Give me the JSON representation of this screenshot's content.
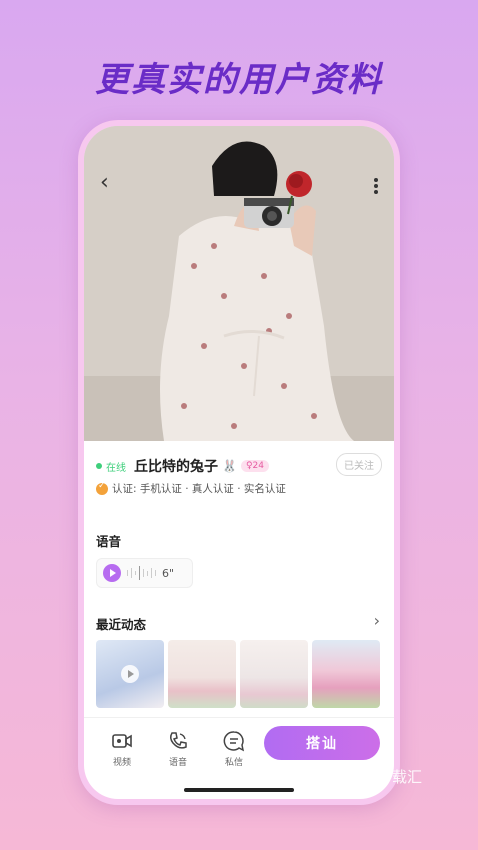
{
  "headline": "更真实的用户资料",
  "profile": {
    "online_status": "在线",
    "username": "丘比特的兔子",
    "rabbit_emoji": "🐰",
    "age_badge": "♀24",
    "follow_label": "已关注",
    "verification": "认证: 手机认证 · 真人认证 · 实名认证"
  },
  "voice": {
    "section_title": "语音",
    "duration": "6\""
  },
  "recent": {
    "section_title": "最近动态",
    "more_icon": "chevron-right-icon"
  },
  "bottom_bar": {
    "video_label": "视频",
    "voice_label": "语音",
    "message_label": "私信",
    "chat_button": "搭讪"
  },
  "watermark": "载汇",
  "colors": {
    "accent": "#b16cf2",
    "headline": "#6a2cc7",
    "online": "#3ecf7b"
  }
}
